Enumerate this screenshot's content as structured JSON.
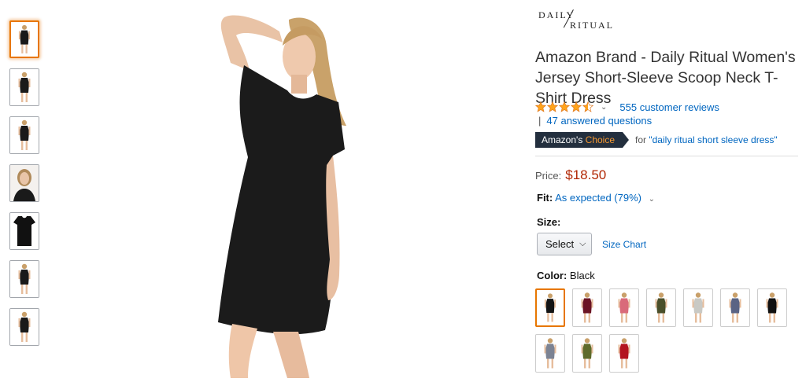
{
  "thumbnails": [
    {
      "kind": "full-front",
      "color": "#1a1a1a",
      "selected": true
    },
    {
      "kind": "full-walk",
      "color": "#1a1a1a",
      "selected": false
    },
    {
      "kind": "full-side",
      "color": "#1a1a1a",
      "selected": false
    },
    {
      "kind": "portrait",
      "color": "#1a1a1a",
      "selected": false
    },
    {
      "kind": "flat-dress",
      "color": "#111111",
      "selected": false
    },
    {
      "kind": "full-front",
      "color": "#1a1a1a",
      "selected": false
    },
    {
      "kind": "full-back",
      "color": "#1a1a1a",
      "selected": false
    }
  ],
  "brand": {
    "line1": "DAILY",
    "line2": "RITUAL"
  },
  "product": {
    "title": "Amazon Brand - Daily Ritual Women's Jersey Short-Sleeve Scoop Neck T-Shirt Dress",
    "rating": 4.5,
    "reviews_link": "555 customer reviews",
    "qa_separator": "|",
    "qa_link": "47 answered questions",
    "badge_prefix": "Amazon's",
    "badge_choice": "Choice",
    "badge_for": "for",
    "badge_query": "\"daily ritual short sleeve dress\"",
    "price_label": "Price:",
    "price": "$18.50",
    "fit_label": "Fit:",
    "fit_value": "As expected (79%)",
    "size_label": "Size:",
    "size_select": "Select",
    "size_chart": "Size Chart",
    "color_label": "Color:",
    "color_value": "Black"
  },
  "colors": {
    "accent_orange": "#e77600",
    "link_blue": "#0066c0",
    "price_red": "#b12704",
    "star_gold": "#ffa41c",
    "badge_navy": "#232f3e"
  },
  "swatches": [
    {
      "color": "#141414",
      "selected": true
    },
    {
      "color": "#6b1424",
      "selected": false
    },
    {
      "color": "#d96a7a",
      "selected": false
    },
    {
      "color": "#4a4f2a",
      "selected": false
    },
    {
      "color": "#c9c9c4",
      "selected": false
    },
    {
      "color": "#5a6384",
      "selected": false
    },
    {
      "color": "#111111",
      "selected": false
    },
    {
      "color": "#7c8393",
      "selected": false
    },
    {
      "color": "#5f6b2b",
      "selected": false
    },
    {
      "color": "#b3141f",
      "selected": false
    }
  ]
}
